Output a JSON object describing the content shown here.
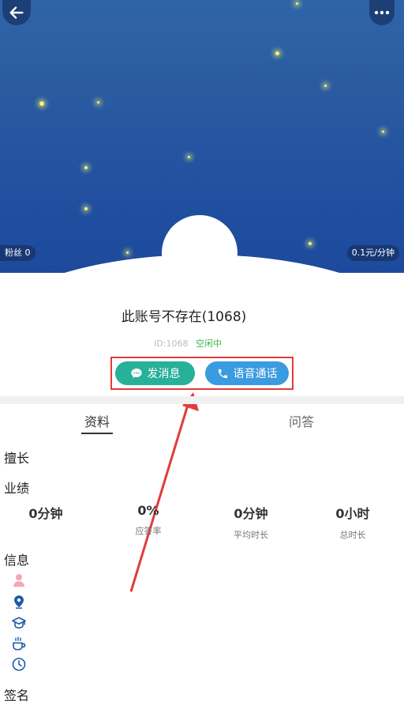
{
  "header": {
    "fans_label": "粉丝 0",
    "price_label": "0.1元/分钟"
  },
  "profile": {
    "name": "此账号不存在(1068)",
    "id_label": "ID:1068",
    "status": "空闲中"
  },
  "actions": {
    "message_label": "发消息",
    "call_label": "语音通话"
  },
  "tabs": {
    "profile_tab": "资料",
    "qa_tab": "问答"
  },
  "sections": {
    "specialty": "擅长",
    "performance": "业绩",
    "info": "信息",
    "signature": "签名"
  },
  "stats": [
    {
      "value": "0分钟",
      "label": ""
    },
    {
      "value": "0%",
      "label": "应答率"
    },
    {
      "value": "0分钟",
      "label": "平均时长"
    },
    {
      "value": "0小时",
      "label": "总时长"
    }
  ],
  "colors": {
    "message_button": "#27b09a",
    "call_button": "#3a9be0",
    "status_online": "#3ab54a",
    "highlight_red": "#e23b3b"
  },
  "icons": {
    "info_items": [
      "gender-icon",
      "location-icon",
      "education-icon",
      "hobby-icon",
      "time-icon"
    ]
  }
}
